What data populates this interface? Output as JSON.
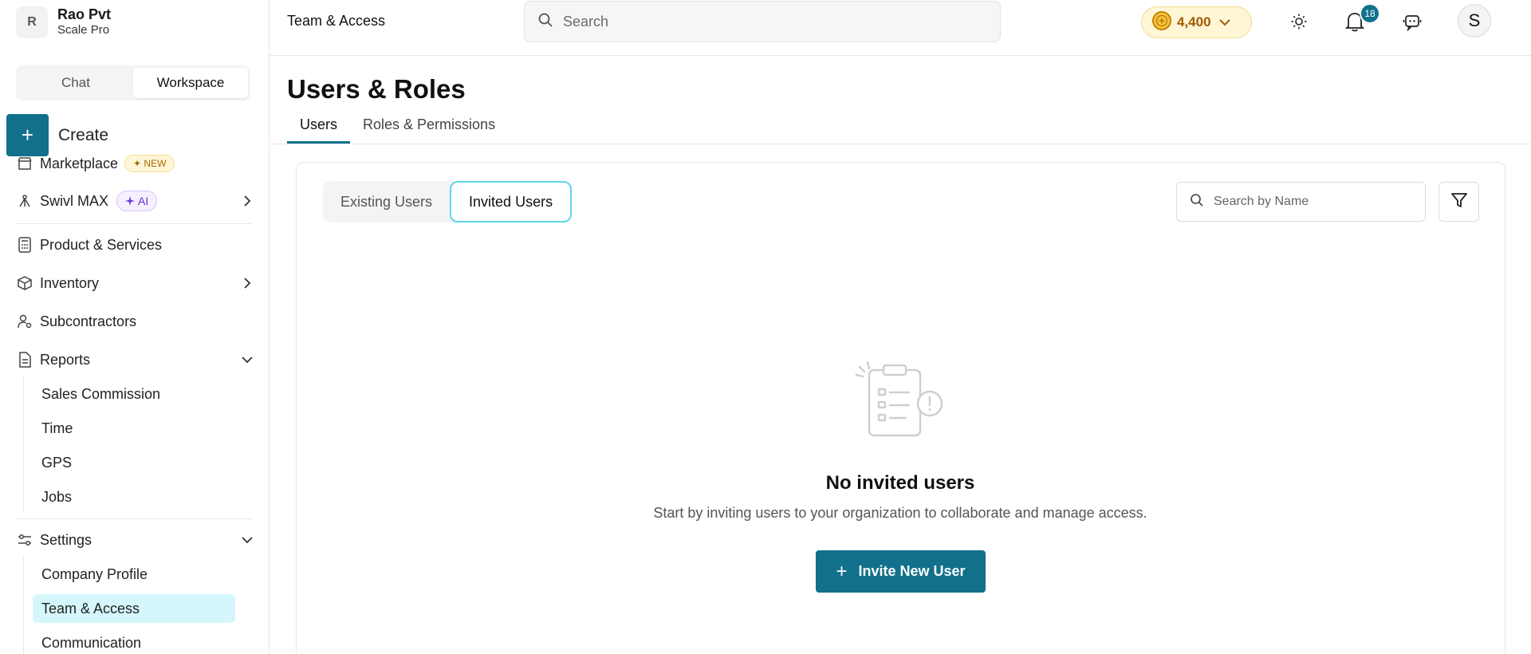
{
  "org": {
    "initial": "R",
    "name": "Rao Pvt",
    "plan": "Scale Pro"
  },
  "mode_switch": {
    "chat": "Chat",
    "workspace": "Workspace"
  },
  "create": {
    "label": "Create"
  },
  "sidebar": {
    "marketplace": {
      "label": "Marketplace",
      "badge": "✦ NEW"
    },
    "swivl_max": {
      "label": "Swivl MAX",
      "badge": "AI"
    },
    "product_services": "Product & Services",
    "inventory": "Inventory",
    "subcontractors": "Subcontractors",
    "reports": {
      "label": "Reports",
      "children": [
        "Sales Commission",
        "Time",
        "GPS",
        "Jobs"
      ]
    },
    "settings": {
      "label": "Settings",
      "children": [
        "Company Profile",
        "Team & Access",
        "Communication"
      ],
      "active_child": "Team & Access"
    }
  },
  "topbar": {
    "title": "Team & Access",
    "search_placeholder": "Search",
    "credits": "4,400",
    "notifications_count": "18",
    "user_initial": "S"
  },
  "page": {
    "title": "Users & Roles",
    "tabs": [
      "Users",
      "Roles & Permissions"
    ],
    "active_tab": "Users"
  },
  "users_panel": {
    "segments": [
      "Existing Users",
      "Invited Users"
    ],
    "active_segment": "Invited Users",
    "search_placeholder": "Search by Name",
    "empty_title": "No invited users",
    "empty_description": "Start by inviting users to your organization to collaborate and manage access.",
    "invite_button": "Invite New User"
  },
  "colors": {
    "primary": "#11708c",
    "active_nav_bg": "#d5f7fb",
    "segment_active_border": "#5fd6ea",
    "credits_bg": "#fff6d6",
    "credits_text": "#a05a00",
    "ai_badge": "#6b33d9"
  }
}
